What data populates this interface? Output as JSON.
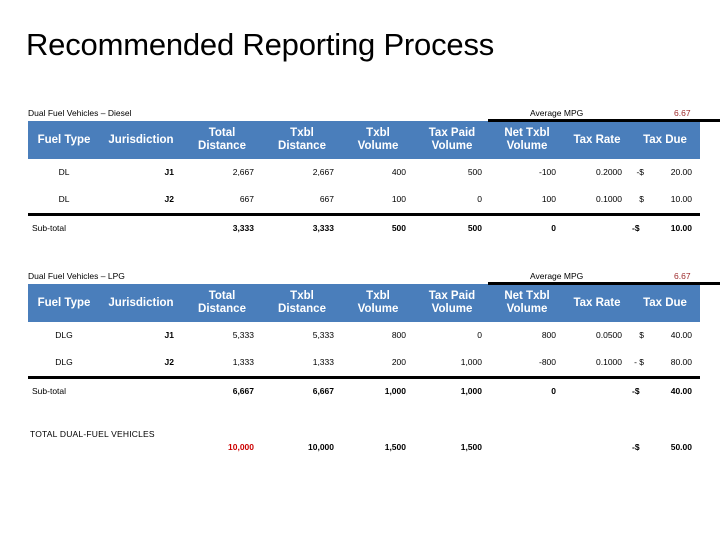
{
  "slide": {
    "title": "Recommended Reporting Process"
  },
  "colors": {
    "header_blue": "#4a7ebb",
    "jurisdiction_blue": "#1f3864",
    "dark_red": "#9e2a2b",
    "bright_red": "#cc0000",
    "rule_black": "#000000"
  },
  "columns": [
    "Fuel Type",
    "Jurisdiction",
    "Total Distance",
    "Txbl Distance",
    "Txbl Volume",
    "Tax Paid Volume",
    "Net Txbl Volume",
    "Tax Rate",
    "Tax Due"
  ],
  "header_labels": {
    "fuel_type_l1": "Fuel Type",
    "fuel_type_l2": "",
    "jurisdiction_l1": "Jurisdiction",
    "jurisdiction_l2": "",
    "total_distance_l1": "Total",
    "total_distance_l2": "Distance",
    "txbl_distance_l1": "Txbl",
    "txbl_distance_l2": "Distance",
    "txbl_volume_l1": "Txbl",
    "txbl_volume_l2": "Volume",
    "tax_paid_volume_l1": "Tax Paid",
    "tax_paid_volume_l2": "Volume",
    "net_txbl_volume_l1": "Net Txbl",
    "net_txbl_volume_l2": "Volume",
    "tax_rate_l1": "Tax Rate",
    "tax_rate_l2": "",
    "tax_due_l1": "Tax Due",
    "tax_due_l2": ""
  },
  "tables": [
    {
      "caption": "Dual Fuel Vehicles – Diesel",
      "mpg_label": "Average MPG",
      "mpg_value": "6.67",
      "rows": [
        {
          "fuel_type": "DL",
          "jurisdiction": "J1",
          "total_distance": "2,667",
          "txbl_distance": "2,667",
          "txbl_volume": "400",
          "tax_paid_volume": "500",
          "net_txbl_volume": "-100",
          "tax_rate": "0.2000",
          "tax_due_sign": "-$",
          "tax_due": "20.00"
        },
        {
          "fuel_type": "DL",
          "jurisdiction": "J2",
          "total_distance": "667",
          "txbl_distance": "667",
          "txbl_volume": "100",
          "tax_paid_volume": "0",
          "net_txbl_volume": "100",
          "tax_rate": "0.1000",
          "tax_due_sign": "$",
          "tax_due": "10.00"
        }
      ],
      "subtotal": {
        "label": "Sub-total",
        "fuel_type": "",
        "jurisdiction": "",
        "total_distance": "3,333",
        "txbl_distance": "3,333",
        "txbl_volume": "500",
        "tax_paid_volume": "500",
        "net_txbl_volume": "0",
        "tax_rate": "",
        "tax_due_sign": "-$",
        "tax_due": "10.00"
      }
    },
    {
      "caption": "Dual Fuel Vehicles – LPG",
      "mpg_label": "Average MPG",
      "mpg_value": "6.67",
      "rows": [
        {
          "fuel_type": "DLG",
          "jurisdiction": "J1",
          "total_distance": "5,333",
          "txbl_distance": "5,333",
          "txbl_volume": "800",
          "tax_paid_volume": "0",
          "net_txbl_volume": "800",
          "tax_rate": "0.0500",
          "tax_due_sign": "$",
          "tax_due": "40.00"
        },
        {
          "fuel_type": "DLG",
          "jurisdiction": "J2",
          "total_distance": "1,333",
          "txbl_distance": "1,333",
          "txbl_volume": "200",
          "tax_paid_volume": "1,000",
          "net_txbl_volume": "-800",
          "tax_rate": "0.1000",
          "tax_due_sign": "- $",
          "tax_due": "80.00"
        }
      ],
      "subtotal": {
        "label": "Sub-total",
        "fuel_type": "",
        "jurisdiction": "",
        "total_distance": "6,667",
        "txbl_distance": "6,667",
        "txbl_volume": "1,000",
        "tax_paid_volume": "1,000",
        "net_txbl_volume": "0",
        "tax_rate": "",
        "tax_due_sign": "-$",
        "tax_due": "40.00"
      }
    }
  ],
  "grand_total": {
    "label": "TOTAL DUAL-FUEL VEHICLES",
    "total_distance": "10,000",
    "txbl_distance": "10,000",
    "txbl_volume": "1,500",
    "tax_paid_volume": "1,500",
    "net_txbl_volume": "",
    "tax_rate": "",
    "tax_due_sign": "-$",
    "tax_due": "50.00"
  }
}
